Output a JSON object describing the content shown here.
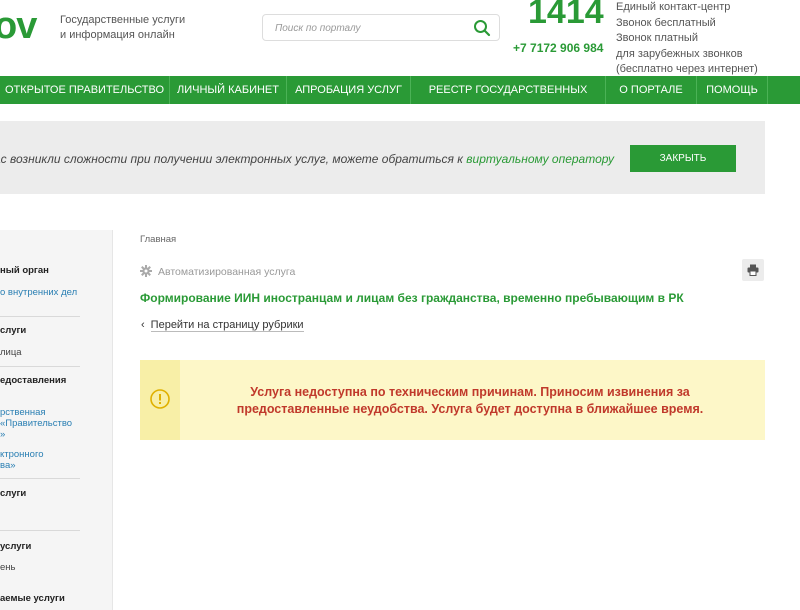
{
  "header": {
    "logo_text": "ov",
    "tagline_line1": "Государственные услуги",
    "tagline_line2": "и информация онлайн",
    "search_placeholder": "Поиск по порталу",
    "phone_short": "1414",
    "phone_long": "+7 7172 906 984",
    "contact_line1": "Единый контакт-центр",
    "contact_line2": "Звонок бесплатный",
    "contact_line3": "Звонок платный",
    "contact_line4": "для зарубежных звонков",
    "contact_line5": "(бесплатно через интернет)"
  },
  "nav": {
    "items": [
      {
        "label": "ОТКРЫТОЕ ПРАВИТЕЛЬСТВО"
      },
      {
        "label": "ЛИЧНЫЙ КАБИНЕТ"
      },
      {
        "label": "АПРОБАЦИЯ УСЛУГ"
      },
      {
        "label": "РЕЕСТР ГОСУДАРСТВЕННЫХ УСЛУГ"
      },
      {
        "label": "О ПОРТАЛЕ"
      },
      {
        "label": "ПОМОЩЬ"
      }
    ]
  },
  "banner": {
    "text": "ас возникли сложности при получении электронных услуг, можете обратиться к ",
    "link": "виртуальному оператору",
    "close_label": "ЗАКРЫТЬ"
  },
  "sidebar": {
    "items": [
      {
        "text": "ный орган"
      },
      {
        "text": "о внутренних дел"
      },
      {
        "text": "слуги"
      },
      {
        "text": "лица"
      },
      {
        "text": "едоставления"
      },
      {
        "text": "рственная"
      },
      {
        "text": "«Правительство"
      },
      {
        "text": "»"
      },
      {
        "text": "ктронного"
      },
      {
        "text": "ва»"
      },
      {
        "text": "слуги"
      },
      {
        "text": "услуги"
      },
      {
        "text": "ень"
      },
      {
        "text": "аемые услуги"
      }
    ]
  },
  "main": {
    "breadcrumb": "Главная",
    "service_type": "Автоматизированная услуга",
    "title": "Формирование ИИН иностранцам и лицам без гражданства, временно пребывающим в РК",
    "back_link": "Перейти на страницу рубрики",
    "alert_text": "Услуга недоступна по техническим причинам. Приносим извинения за предоставленные неудобства. Услуга будет доступна в ближайшее время."
  },
  "colors": {
    "brand_green": "#2a9a36",
    "alert_bg": "#fdf7c8",
    "alert_text": "#c0392b"
  },
  "icons": {
    "search": "search-icon",
    "gear": "gear-icon",
    "print": "printer-icon",
    "info": "info-icon",
    "back": "chevron-left-icon"
  }
}
